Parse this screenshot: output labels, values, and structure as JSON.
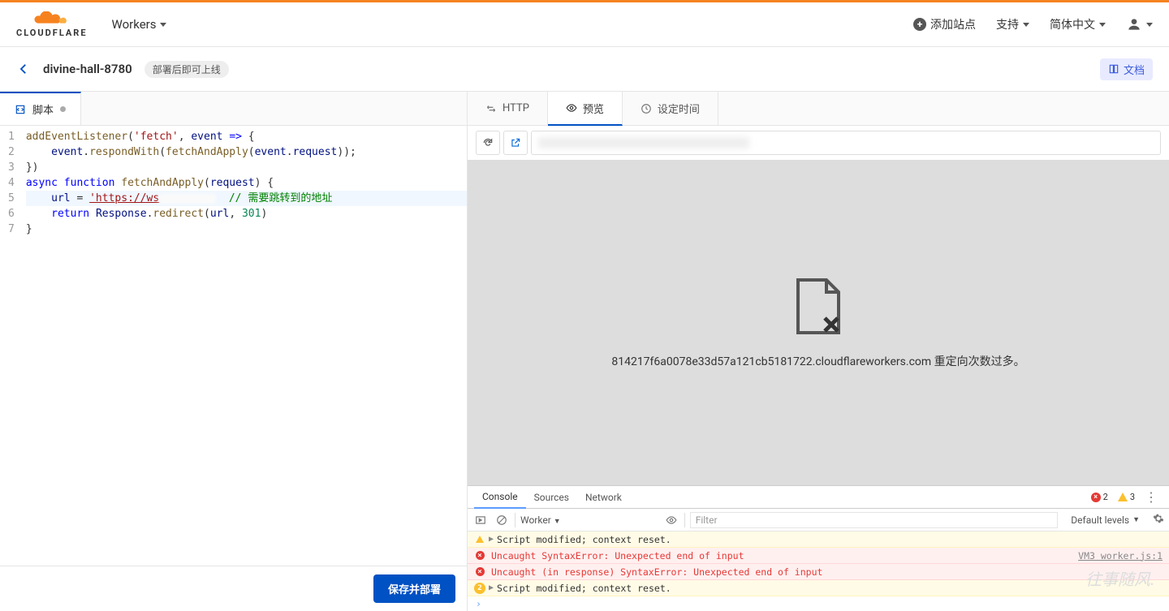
{
  "header": {
    "logo_text": "CLOUDFLARE",
    "workers_label": "Workers",
    "add_site": "添加站点",
    "support": "支持",
    "language": "简体中文"
  },
  "sub": {
    "name": "divine-hall-8780",
    "status": "部署后即可上线",
    "docs": "文档"
  },
  "editor": {
    "tab": "脚本",
    "lines": {
      "1": "addEventListener('fetch', event => {",
      "2": "    event.respondWith(fetchAndApply(event.request));",
      "3": "})",
      "4": "async function fetchAndApply(request) {",
      "5a": "    url = ",
      "5b": "'https://ws",
      "5c": "// 需要跳转到的地址",
      "6a": "    return Response.",
      "6b": "redirect",
      "6c": "(url, ",
      "6d": "301",
      "6e": ")",
      "7": "}"
    },
    "deploy": "保存并部署"
  },
  "preview": {
    "tab_http": "HTTP",
    "tab_preview": "预览",
    "tab_schedule": "设定时间",
    "error_text": "814217f6a0078e33d57a121cb5181722.cloudflareworkers.com 重定向次数过多。"
  },
  "devtools": {
    "console": "Console",
    "sources": "Sources",
    "network": "Network",
    "err_count": "2",
    "warn_count": "3",
    "worker_sel": "Worker",
    "filter_ph": "Filter",
    "levels": "Default levels",
    "lines": {
      "warn1": "Script modified; context reset.",
      "err1": "Uncaught SyntaxError: Unexpected end of input",
      "err1_src": "VM3 worker.js:1",
      "err2": "Uncaught (in response) SyntaxError: Unexpected end of input",
      "warn2_count": "2",
      "warn2": "Script modified; context reset."
    }
  },
  "watermark": "往事随风."
}
